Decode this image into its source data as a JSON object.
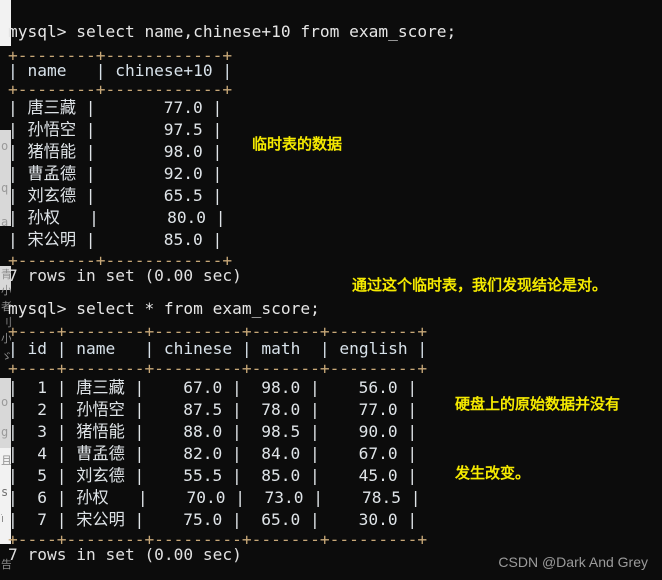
{
  "terminal": {
    "background": "#0c0c0c",
    "border_color": "#c8a878",
    "text_color": "#e6e6e6",
    "annotation_color": "#f5ea00",
    "query1": "mysql> select name,chinese+10 from exam_score;",
    "query2": "mysql> select * from exam_score;",
    "result1_status": "7 rows in set (0.00 sec)",
    "result2_status": "7 rows in set (0.00 sec)"
  },
  "table1": {
    "top_rule": "+--------+------------+",
    "header_row": "| name   | chinese+10 |",
    "mid_rule": "+--------+------------+",
    "bottom_rule": "+--------+------------+",
    "columns": [
      "name",
      "chinese+10"
    ],
    "rows": [
      {
        "line": "| 唐三藏 |       77.0 |",
        "name": "唐三藏",
        "value": "77.0"
      },
      {
        "line": "| 孙悟空 |       97.5 |",
        "name": "孙悟空",
        "value": "97.5"
      },
      {
        "line": "| 猪悟能 |       98.0 |",
        "name": "猪悟能",
        "value": "98.0"
      },
      {
        "line": "| 曹孟德 |       92.0 |",
        "name": "曹孟德",
        "value": "92.0"
      },
      {
        "line": "| 刘玄德 |       65.5 |",
        "name": "刘玄德",
        "value": "65.5"
      },
      {
        "line": "| 孙权   |       80.0 |",
        "name": "孙权",
        "value": "80.0"
      },
      {
        "line": "| 宋公明 |       85.0 |",
        "name": "宋公明",
        "value": "85.0"
      }
    ]
  },
  "table2": {
    "top_rule": "+----+--------+---------+-------+---------+",
    "header_row": "| id | name   | chinese | math  | english |",
    "mid_rule": "+----+--------+---------+-------+---------+",
    "bottom_rule": "+----+--------+---------+-------+---------+",
    "columns": [
      "id",
      "name",
      "chinese",
      "math",
      "english"
    ],
    "rows": [
      {
        "line": "|  1 | 唐三藏 |    67.0 |  98.0 |    56.0 |",
        "id": "1",
        "name": "唐三藏",
        "chinese": "67.0",
        "math": "98.0",
        "english": "56.0"
      },
      {
        "line": "|  2 | 孙悟空 |    87.5 |  78.0 |    77.0 |",
        "id": "2",
        "name": "孙悟空",
        "chinese": "87.5",
        "math": "78.0",
        "english": "77.0"
      },
      {
        "line": "|  3 | 猪悟能 |    88.0 |  98.5 |    90.0 |",
        "id": "3",
        "name": "猪悟能",
        "chinese": "88.0",
        "math": "98.5",
        "english": "90.0"
      },
      {
        "line": "|  4 | 曹孟德 |    82.0 |  84.0 |    67.0 |",
        "id": "4",
        "name": "曹孟德",
        "chinese": "82.0",
        "math": "84.0",
        "english": "67.0"
      },
      {
        "line": "|  5 | 刘玄德 |    55.5 |  85.0 |    45.0 |",
        "id": "5",
        "name": "刘玄德",
        "chinese": "55.5",
        "math": "85.0",
        "english": "45.0"
      },
      {
        "line": "|  6 | 孙权   |    70.0 |  73.0 |    78.5 |",
        "id": "6",
        "name": "孙权",
        "chinese": "70.0",
        "math": "73.0",
        "english": "78.5"
      },
      {
        "line": "|  7 | 宋公明 |    75.0 |  65.0 |    30.0 |",
        "id": "7",
        "name": "宋公明",
        "chinese": "75.0",
        "math": "65.0",
        "english": "30.0"
      }
    ]
  },
  "annotations": {
    "temp_table": "临时表的数据",
    "conclusion": "通过这个临时表，我们发现结论是对。",
    "disk_line1": "硬盘上的原始数据并没有",
    "disk_line2": "发生改变。"
  },
  "watermark": "CSDN @Dark And Grey",
  "edge_fragments": [
    "o",
    "q",
    "a",
    "青",
    "小",
    "者",
    "刂",
    "小",
    "ゞ",
    "o",
    "g",
    "且",
    "s",
    "וֹ",
    "告"
  ]
}
